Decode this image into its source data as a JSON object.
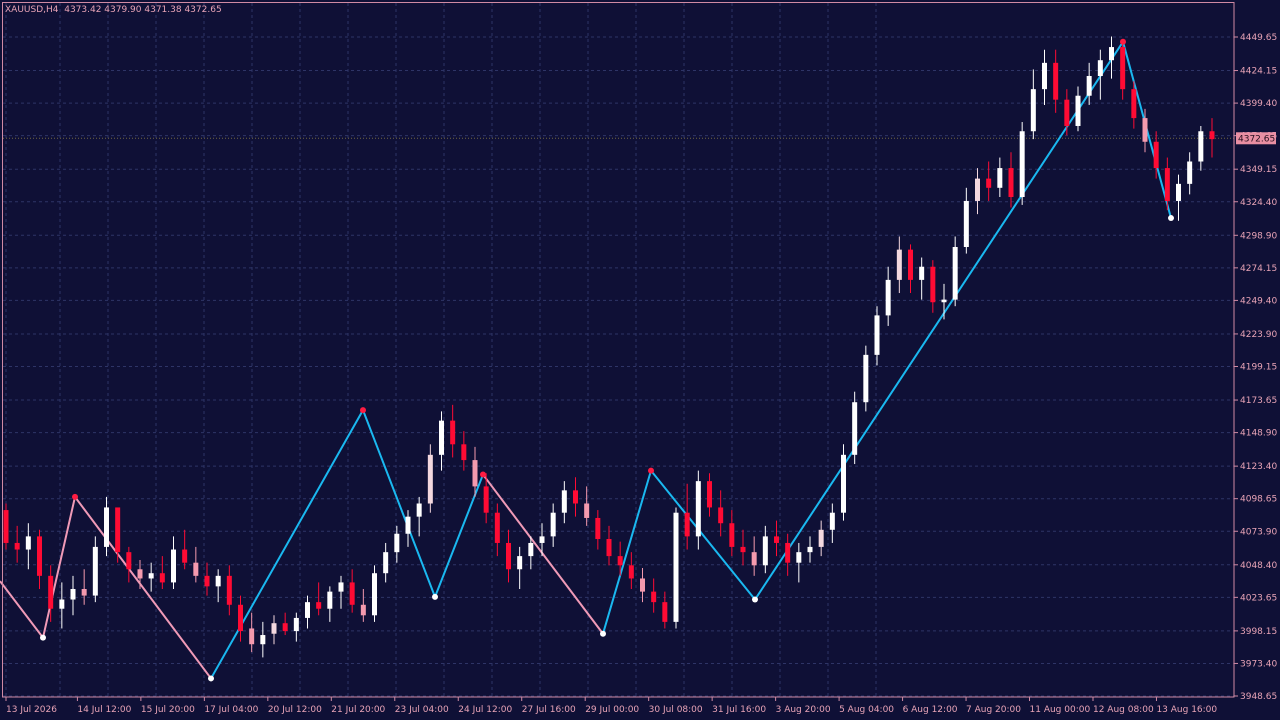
{
  "header": {
    "symbol_info": "XAUUSD,H4  4373.42 4379.90 4371.38 4372.65"
  },
  "colors": {
    "background": "#0f1036",
    "grid": "#2e3466",
    "frame": "#d08aa4",
    "text": "#e7a3b6",
    "bull": "#ffffff",
    "bull_light": "#f4d8df",
    "bear": "#ff0b34",
    "bear_light": "#f49aae",
    "zigzag_main": "#1ab8f0",
    "zigzag_alt": "#f09ab7",
    "swing_high": "#ff1c42",
    "swing_low": "#ffffff",
    "price_tag": "#e98fa3",
    "price_line": "#b3a24d"
  },
  "chart_data": {
    "type": "candlestick",
    "symbol": "XAUUSD",
    "timeframe": "H4",
    "ohlc_current": {
      "open": 4373.42,
      "high": 4379.9,
      "low": 4371.38,
      "close": 4372.65
    },
    "current_price_label": "4372.65",
    "ylim": [
      3945,
      4470
    ],
    "grid": true,
    "y_ticks": [
      "4449.65",
      "4424.15",
      "4399.40",
      "4374.65",
      "4349.15",
      "4324.40",
      "4298.90",
      "4274.15",
      "4249.40",
      "4223.90",
      "4199.15",
      "4173.65",
      "4148.90",
      "4123.40",
      "4098.65",
      "4073.90",
      "4048.40",
      "4023.65",
      "3998.15",
      "3973.40",
      "3948.65"
    ],
    "x_ticks": [
      {
        "label": "13 Jul 2026",
        "index": 0
      },
      {
        "label": "14 Jul 12:00",
        "index": 9
      },
      {
        "label": "15 Jul 20:00",
        "index": 17
      },
      {
        "label": "17 Jul 04:00",
        "index": 25
      },
      {
        "label": "20 Jul 12:00",
        "index": 33
      },
      {
        "label": "21 Jul 20:00",
        "index": 41
      },
      {
        "label": "23 Jul 04:00",
        "index": 49
      },
      {
        "label": "24 Jul 12:00",
        "index": 57
      },
      {
        "label": "27 Jul 16:00",
        "index": 65
      },
      {
        "label": "29 Jul 00:00",
        "index": 73
      },
      {
        "label": "30 Jul 08:00",
        "index": 81
      },
      {
        "label": "31 Jul 16:00",
        "index": 89
      },
      {
        "label": "3 Aug 20:00",
        "index": 97
      },
      {
        "label": "5 Aug 04:00",
        "index": 105
      },
      {
        "label": "6 Aug 12:00",
        "index": 113
      },
      {
        "label": "7 Aug 20:00",
        "index": 121
      },
      {
        "label": "11 Aug 00:00",
        "index": 129
      },
      {
        "label": "12 Aug 08:00",
        "index": 137
      },
      {
        "label": "13 Aug 16:00",
        "index": 145
      }
    ],
    "candles": [
      [
        4090,
        4095,
        4060,
        4065
      ],
      [
        4065,
        4078,
        4050,
        4060
      ],
      [
        4060,
        4080,
        4045,
        4070
      ],
      [
        4070,
        4075,
        4030,
        4040
      ],
      [
        4040,
        4048,
        4005,
        4015
      ],
      [
        4015,
        4035,
        4000,
        4022
      ],
      [
        4022,
        4040,
        4010,
        4030
      ],
      [
        4030,
        4045,
        4018,
        4025
      ],
      [
        4025,
        4070,
        4020,
        4062
      ],
      [
        4062,
        4100,
        4055,
        4092
      ],
      [
        4092,
        4085,
        4050,
        4058
      ],
      [
        4058,
        4062,
        4035,
        4045
      ],
      [
        4045,
        4052,
        4030,
        4038
      ],
      [
        4038,
        4050,
        4028,
        4042
      ],
      [
        4042,
        4055,
        4030,
        4035
      ],
      [
        4035,
        4070,
        4030,
        4060
      ],
      [
        4060,
        4075,
        4045,
        4050
      ],
      [
        4050,
        4062,
        4035,
        4040
      ],
      [
        4040,
        4050,
        4025,
        4032
      ],
      [
        4032,
        4045,
        4020,
        4040
      ],
      [
        4040,
        4048,
        4010,
        4018
      ],
      [
        4018,
        4025,
        3990,
        3998
      ],
      [
        4000,
        4012,
        3982,
        3988
      ],
      [
        3988,
        4005,
        3978,
        3995
      ],
      [
        3996,
        4010,
        3988,
        4004
      ],
      [
        4004,
        4012,
        3995,
        3998
      ],
      [
        3998,
        4012,
        3990,
        4008
      ],
      [
        4008,
        4025,
        4000,
        4020
      ],
      [
        4020,
        4035,
        4010,
        4015
      ],
      [
        4015,
        4032,
        4005,
        4028
      ],
      [
        4028,
        4040,
        4015,
        4035
      ],
      [
        4035,
        4045,
        4012,
        4018
      ],
      [
        4018,
        4030,
        4005,
        4010
      ],
      [
        4010,
        4048,
        4005,
        4042
      ],
      [
        4042,
        4065,
        4035,
        4058
      ],
      [
        4058,
        4078,
        4050,
        4072
      ],
      [
        4072,
        4090,
        4062,
        4085
      ],
      [
        4085,
        4100,
        4070,
        4095
      ],
      [
        4095,
        4140,
        4088,
        4132
      ],
      [
        4132,
        4165,
        4120,
        4158
      ],
      [
        4158,
        4170,
        4130,
        4140
      ],
      [
        4140,
        4150,
        4120,
        4128
      ],
      [
        4128,
        4138,
        4100,
        4108
      ],
      [
        4108,
        4118,
        4080,
        4088
      ],
      [
        4088,
        4095,
        4055,
        4065
      ],
      [
        4065,
        4075,
        4035,
        4045
      ],
      [
        4045,
        4062,
        4030,
        4055
      ],
      [
        4055,
        4070,
        4045,
        4065
      ],
      [
        4065,
        4080,
        4055,
        4070
      ],
      [
        4070,
        4095,
        4062,
        4088
      ],
      [
        4088,
        4112,
        4080,
        4105
      ],
      [
        4105,
        4115,
        4085,
        4095
      ],
      [
        4095,
        4108,
        4078,
        4084
      ],
      [
        4084,
        4090,
        4060,
        4068
      ],
      [
        4068,
        4078,
        4048,
        4055
      ],
      [
        4055,
        4066,
        4040,
        4048
      ],
      [
        4048,
        4058,
        4030,
        4038
      ],
      [
        4038,
        4046,
        4020,
        4028
      ],
      [
        4028,
        4038,
        4012,
        4020
      ],
      [
        4020,
        4028,
        4000,
        4005
      ],
      [
        4005,
        4092,
        4000,
        4088
      ],
      [
        4088,
        4110,
        4060,
        4070
      ],
      [
        4070,
        4120,
        4060,
        4112
      ],
      [
        4112,
        4118,
        4085,
        4092
      ],
      [
        4092,
        4105,
        4070,
        4080
      ],
      [
        4080,
        4090,
        4055,
        4062
      ],
      [
        4062,
        4075,
        4048,
        4058
      ],
      [
        4058,
        4070,
        4040,
        4048
      ],
      [
        4048,
        4078,
        4042,
        4070
      ],
      [
        4070,
        4082,
        4055,
        4065
      ],
      [
        4065,
        4072,
        4040,
        4050
      ],
      [
        4050,
        4065,
        4035,
        4058
      ],
      [
        4058,
        4070,
        4050,
        4062
      ],
      [
        4062,
        4082,
        4055,
        4075
      ],
      [
        4075,
        4095,
        4065,
        4088
      ],
      [
        4088,
        4140,
        4082,
        4132
      ],
      [
        4132,
        4180,
        4125,
        4172
      ],
      [
        4172,
        4215,
        4165,
        4208
      ],
      [
        4208,
        4245,
        4200,
        4238
      ],
      [
        4238,
        4275,
        4230,
        4265
      ],
      [
        4265,
        4298,
        4255,
        4288
      ],
      [
        4288,
        4292,
        4255,
        4265
      ],
      [
        4265,
        4282,
        4250,
        4275
      ],
      [
        4275,
        4280,
        4240,
        4248
      ],
      [
        4248,
        4262,
        4235,
        4250
      ],
      [
        4250,
        4298,
        4245,
        4290
      ],
      [
        4290,
        4335,
        4285,
        4325
      ],
      [
        4325,
        4350,
        4315,
        4342
      ],
      [
        4342,
        4355,
        4325,
        4335
      ],
      [
        4335,
        4358,
        4328,
        4350
      ],
      [
        4350,
        4362,
        4320,
        4328
      ],
      [
        4328,
        4385,
        4322,
        4378
      ],
      [
        4378,
        4425,
        4372,
        4410
      ],
      [
        4410,
        4440,
        4398,
        4430
      ],
      [
        4430,
        4440,
        4392,
        4402
      ],
      [
        4402,
        4410,
        4375,
        4382
      ],
      [
        4382,
        4412,
        4378,
        4405
      ],
      [
        4405,
        4430,
        4398,
        4420
      ],
      [
        4420,
        4440,
        4402,
        4432
      ],
      [
        4432,
        4450,
        4418,
        4442
      ],
      [
        4442,
        4448,
        4402,
        4410
      ],
      [
        4410,
        4416,
        4380,
        4388
      ],
      [
        4388,
        4395,
        4362,
        4370
      ],
      [
        4370,
        4378,
        4342,
        4350
      ],
      [
        4350,
        4358,
        4318,
        4325
      ],
      [
        4325,
        4345,
        4310,
        4338
      ],
      [
        4338,
        4362,
        4330,
        4355
      ],
      [
        4355,
        4382,
        4348,
        4378
      ],
      [
        4378,
        4388,
        4358,
        4372
      ]
    ],
    "x_positions": [
      3,
      10,
      15,
      21,
      27,
      33,
      39,
      45,
      51,
      57,
      63,
      68,
      74,
      80,
      86,
      92,
      98,
      104,
      110,
      116,
      122,
      128,
      134,
      140,
      146,
      152,
      158,
      164,
      170,
      176,
      182,
      188,
      194,
      200,
      206,
      212,
      218,
      224,
      230,
      236,
      242,
      248,
      254,
      260,
      266,
      272,
      278,
      284,
      290,
      296,
      302,
      308,
      314,
      320,
      326,
      332,
      338,
      344,
      350,
      356,
      362,
      368,
      374,
      380,
      386,
      392,
      398,
      404,
      410,
      416,
      422,
      428,
      434,
      440,
      446,
      452,
      458,
      464,
      470,
      476,
      482,
      488,
      494,
      500,
      506,
      512,
      518,
      524,
      530,
      536,
      542,
      548,
      554,
      560,
      566,
      572,
      578,
      584,
      590,
      596,
      602,
      608,
      614,
      620,
      626,
      632,
      638,
      644,
      650,
      656,
      662,
      668,
      674,
      680,
      686,
      692,
      698,
      704,
      710,
      716,
      722,
      728,
      734,
      740,
      746,
      752,
      758,
      764,
      770,
      776,
      782,
      788,
      794,
      800,
      806,
      812,
      818,
      824,
      830,
      836,
      842,
      848,
      854,
      860,
      866,
      872,
      878,
      884,
      890,
      896,
      902,
      908,
      914,
      920,
      926,
      932,
      938,
      944,
      950,
      956,
      962,
      968,
      974,
      980,
      986,
      992,
      998,
      1004,
      1010,
      1016,
      1022,
      1028,
      1034,
      1040,
      1046,
      1052,
      1058,
      1064,
      1070,
      1076,
      1082,
      1088,
      1094,
      1100,
      1106,
      1112,
      1118,
      1124,
      1130,
      1136,
      1142,
      1148,
      1154,
      1160,
      1166,
      1172,
      1178,
      1184,
      1190,
      1196,
      1202,
      1208,
      1214
    ],
    "zigzag": [
      {
        "series": "alt",
        "points": [
          [
            0,
            4036
          ],
          [
            43,
            3993
          ],
          [
            75,
            4100
          ],
          [
            211,
            3962
          ]
        ]
      },
      {
        "series": "main",
        "points": [
          [
            211,
            3962
          ],
          [
            363,
            4166
          ],
          [
            435,
            4024
          ],
          [
            483,
            4117
          ]
        ]
      },
      {
        "series": "alt",
        "points": [
          [
            483,
            4117
          ],
          [
            603,
            3996
          ]
        ]
      },
      {
        "series": "main",
        "points": [
          [
            603,
            3996
          ],
          [
            651,
            4120
          ],
          [
            755,
            4022
          ],
          [
            1123,
            4446
          ],
          [
            1171,
            4312
          ]
        ]
      }
    ],
    "swing_points": [
      {
        "x": 43,
        "y": 3993,
        "kind": "low"
      },
      {
        "x": 75,
        "y": 4100,
        "kind": "high"
      },
      {
        "x": 211,
        "y": 3962,
        "kind": "low"
      },
      {
        "x": 363,
        "y": 4166,
        "kind": "high"
      },
      {
        "x": 435,
        "y": 4024,
        "kind": "low"
      },
      {
        "x": 483,
        "y": 4117,
        "kind": "high"
      },
      {
        "x": 603,
        "y": 3996,
        "kind": "low"
      },
      {
        "x": 651,
        "y": 4120,
        "kind": "high"
      },
      {
        "x": 755,
        "y": 4022,
        "kind": "low"
      },
      {
        "x": 1123,
        "y": 4446,
        "kind": "high"
      },
      {
        "x": 1171,
        "y": 4312,
        "kind": "low"
      }
    ]
  }
}
